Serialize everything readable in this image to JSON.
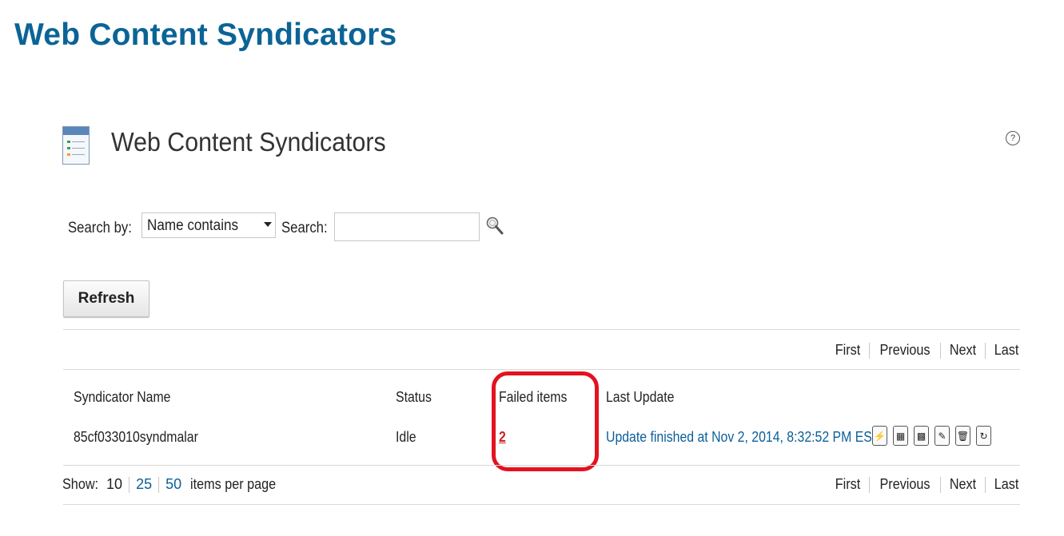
{
  "page": {
    "heading": "Web Content Syndicators"
  },
  "portlet": {
    "title": "Web Content Syndicators",
    "help_icon": "help-icon"
  },
  "search": {
    "search_by_label": "Search by:",
    "search_by_selected": "Name contains",
    "search_label": "Search:",
    "search_value": "",
    "search_button_icon": "magnifier-icon"
  },
  "refresh_label": "Refresh",
  "pager": {
    "first": "First",
    "previous": "Previous",
    "next": "Next",
    "last": "Last"
  },
  "table": {
    "columns": [
      "Syndicator Name",
      "Status",
      "Failed items",
      "Last Update"
    ],
    "rows": [
      {
        "name": "85cf033010syndmalar",
        "status": "Idle",
        "failed_items": "2",
        "last_update": "Update finished at Nov 2, 2014, 8:32:52 PM EST",
        "actions": [
          "update-icon",
          "rebuild-icon",
          "rebuild-all-icon",
          "edit-icon",
          "delete-icon",
          "reset-icon"
        ]
      }
    ]
  },
  "footer": {
    "show_label": "Show:",
    "page_sizes": [
      "10",
      "25",
      "50"
    ],
    "selected_page_size": "10",
    "items_per_page_label": "items per page"
  },
  "highlight": {
    "color": "#e3121f",
    "target": "Failed items"
  }
}
